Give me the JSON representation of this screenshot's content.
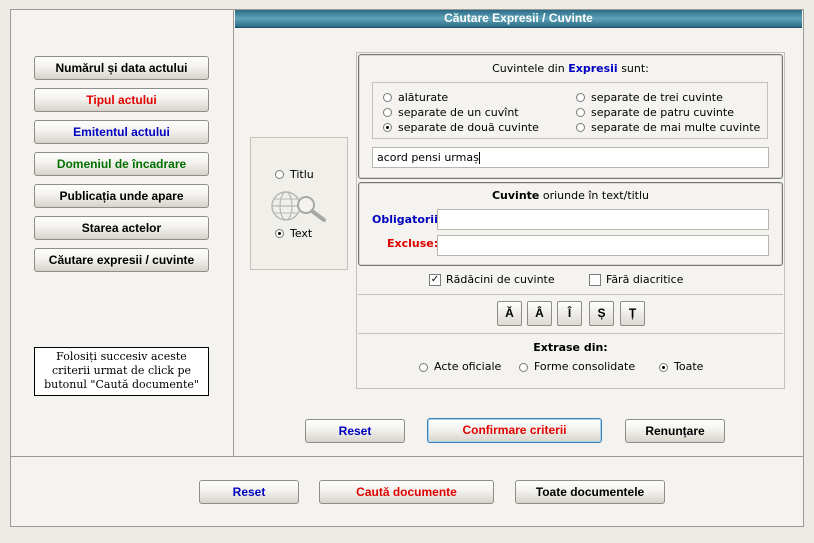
{
  "window": {
    "title": "Căutare Expresii / Cuvinte"
  },
  "sidebar": {
    "buttons": [
      {
        "label": "Numărul și data actului",
        "color": "#000000"
      },
      {
        "label": "Tipul actului",
        "color": "#e00000"
      },
      {
        "label": "Emitentul actului",
        "color": "#0000c0"
      },
      {
        "label": "Domeniul de încadrare",
        "color": "#007000"
      },
      {
        "label": "Publicația unde apare",
        "color": "#000000"
      },
      {
        "label": "Starea actelor",
        "color": "#000000"
      },
      {
        "label": "Căutare expresii / cuvinte",
        "color": "#000000"
      }
    ],
    "hint": "Folosiți succesiv aceste criterii urmat de click pe butonul \"Caută documente\""
  },
  "scope": {
    "option_title": "Titlu",
    "option_text": "Text",
    "selected": "Text",
    "icon": "globe-search-icon"
  },
  "expressions": {
    "header_prefix": "Cuvintele din",
    "header_emphasis": "Expresii",
    "header_suffix": "sunt:",
    "options": [
      {
        "label": "alăturate",
        "checked": false
      },
      {
        "label": "separate de un cuvînt",
        "checked": false
      },
      {
        "label": "separate de două cuvinte",
        "checked": true
      },
      {
        "label": "separate de trei cuvinte",
        "checked": false
      },
      {
        "label": "separate de patru cuvinte",
        "checked": false
      },
      {
        "label": "separate de mai multe cuvinte",
        "checked": false
      }
    ],
    "query_value": "acord pensi urmaș"
  },
  "words": {
    "header_emphasis": "Cuvinte",
    "header_suffix": "oriunde în text/titlu",
    "required_label": "Obligatorii:",
    "excluded_label": "Excluse:",
    "required_value": "",
    "excluded_value": ""
  },
  "options": {
    "roots_label": "Rădăcini de cuvinte",
    "roots_checked": true,
    "nodiacritics_label": "Fără diacritice",
    "nodiacritics_checked": false
  },
  "diacritics": [
    "Ă",
    "Â",
    "Î",
    "Ș",
    "Ț"
  ],
  "extract": {
    "label": "Extrase din:",
    "options": [
      {
        "label": "Acte oficiale",
        "checked": false
      },
      {
        "label": "Forme consolidate",
        "checked": false
      },
      {
        "label": "Toate",
        "checked": true
      }
    ]
  },
  "dialog_buttons": {
    "reset": "Reset",
    "confirm": "Confirmare criterii",
    "cancel": "Renunțare"
  },
  "bottom_buttons": {
    "reset": "Reset",
    "search": "Caută documente",
    "all": "Toate documentele"
  }
}
